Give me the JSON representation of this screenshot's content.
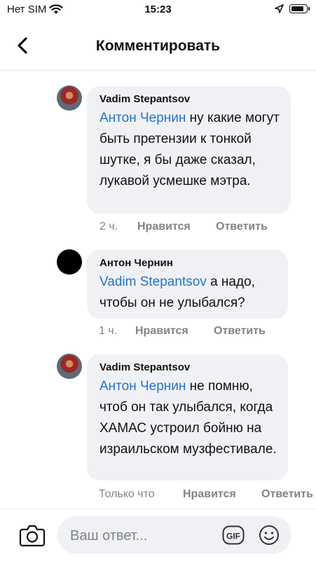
{
  "status_bar": {
    "carrier": "Нет SIM",
    "time": "15:23"
  },
  "header": {
    "title": "Комментировать"
  },
  "comments": [
    {
      "author": "Vadim Stepantsov",
      "mention": "Антон Чернин",
      "text": " ну какие могут быть претензии к тонкой шутке, я бы даже сказал, лукавой усмешке мэтра.",
      "time": "2 ч.",
      "like": "Нравится",
      "reply": "Ответить"
    },
    {
      "author": "Антон Чернин",
      "mention": "Vadim Stepantsov",
      "text": " а надо, чтобы он не улыбался?",
      "time": "1 ч.",
      "like": "Нравится",
      "reply": "Ответить"
    },
    {
      "author": "Vadim Stepantsov",
      "mention": "Антон Чернин",
      "text": " не помню, чтоб он так улыбался, когда ХАМАС устроил бойню на израильском музфестивале.",
      "time": "Только что",
      "like": "Нравится",
      "reply": "Ответить"
    }
  ],
  "composer": {
    "placeholder": "Ваш ответ..."
  },
  "colors": {
    "mention": "#2174cc",
    "bubble": "#f0f1f4",
    "meta": "#808387"
  }
}
